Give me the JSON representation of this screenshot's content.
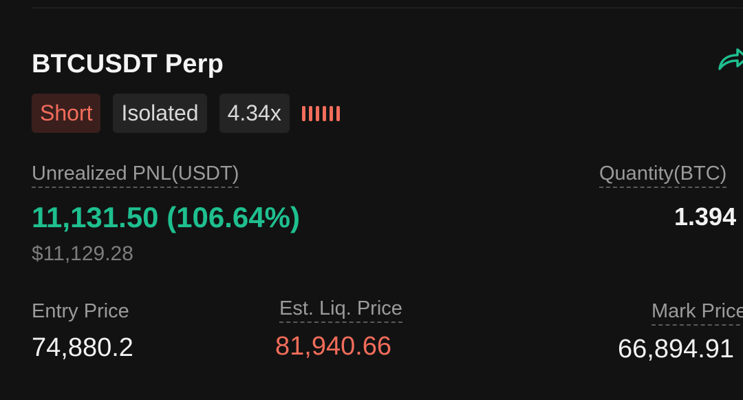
{
  "position": {
    "title": "BTCUSDT Perp",
    "side": "Short",
    "margin_mode": "Isolated",
    "leverage": "4.34x",
    "risk_level_bars": 6
  },
  "pnl": {
    "label": "Unrealized PNL(USDT)",
    "value": "11,131.50 (106.64%)",
    "usd_value": "$11,129.28"
  },
  "quantity": {
    "label": "Quantity(BTC)",
    "value": "1.394"
  },
  "entry_price": {
    "label": "Entry Price",
    "value": "74,880.2"
  },
  "liq_price": {
    "label": "Est. Liq. Price",
    "value": "81,940.66"
  },
  "mark_price": {
    "label": "Mark Price",
    "value": "66,894.91"
  },
  "colors": {
    "background": "#121212",
    "profit": "#1fbf8f",
    "loss": "#f26d5b",
    "badge_bg": "#242424"
  },
  "icons": {
    "share": "share-arrow-icon"
  }
}
